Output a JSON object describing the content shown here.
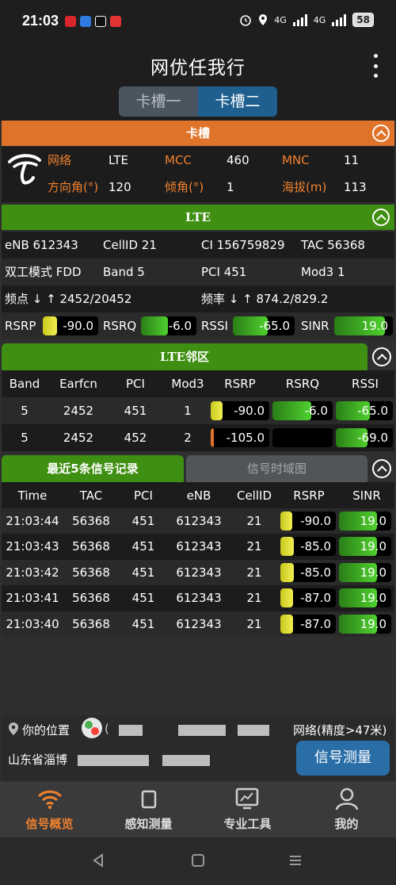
{
  "status": {
    "time": "21:03",
    "battery": "58",
    "net1": "4G",
    "net2": "4G"
  },
  "appbar": {
    "title": "网优任我行"
  },
  "slots": {
    "tab1": "卡槽一",
    "tab2": "卡槽二"
  },
  "sim": {
    "header": "卡槽",
    "row1": {
      "l1": "网络",
      "v1": "LTE",
      "l2": "MCC",
      "v2": "460",
      "l3": "MNC",
      "v3": "11"
    },
    "row2": {
      "l1": "方向角(°)",
      "v1": "120",
      "l2": "倾角(°)",
      "v2": "1",
      "l3": "海拔(m)",
      "v3": "113"
    }
  },
  "lte": {
    "header": "LTE",
    "enb": "eNB 612343",
    "cellid": "CellID 21",
    "ci": "CI 156759829",
    "tac": "TAC 56368",
    "duplex": "双工模式 FDD",
    "band": "Band 5",
    "pci": "PCI 451",
    "mod3": "Mod3 1",
    "freqpoint": "频点 ↓ ↑ 2452/20452",
    "freq": "频率 ↓ ↑ 874.2/829.2",
    "metrics": {
      "rsrp_label": "RSRP",
      "rsrp": "-90.0",
      "rsrp_level": 0.25,
      "rsrq_label": "RSRQ",
      "rsrq": "-6.0",
      "rsrq_level": 0.48,
      "rssi_label": "RSSI",
      "rssi": "-65.0",
      "rssi_level": 0.57,
      "sinr_label": "SINR",
      "sinr": "19.0",
      "sinr_level": 0.86
    }
  },
  "neighbors": {
    "header": "LTE邻区",
    "columns": [
      "Band",
      "Earfcn",
      "PCI",
      "Mod3",
      "RSRP",
      "RSRQ",
      "RSSI"
    ],
    "rows": [
      {
        "band": "5",
        "earfcn": "2452",
        "pci": "451",
        "mod3": "1",
        "rsrp": "-90.0",
        "rsrp_level": 0.2,
        "rsrq": "-6.0",
        "rsrq_level": 0.65,
        "rssi": "-65.0",
        "rssi_level": 0.6
      },
      {
        "band": "5",
        "earfcn": "2452",
        "pci": "452",
        "mod3": "2",
        "rsrp": "-105.0",
        "rsrp_level": 0.05,
        "rsrq": "",
        "rsrq_level": 0,
        "rssi": "-69.0",
        "rssi_level": 0.55
      }
    ]
  },
  "records": {
    "tab_active": "最近5条信号记录",
    "tab_inactive": "信号时域图",
    "columns": [
      "Time",
      "TAC",
      "PCI",
      "eNB",
      "CellID",
      "RSRP",
      "SINR"
    ],
    "rows": [
      {
        "time": "21:03:44",
        "tac": "56368",
        "pci": "451",
        "enb": "612343",
        "cellid": "21",
        "rsrp": "-90.0",
        "rsrp_level": 0.22,
        "sinr": "19.0",
        "sinr_level": 0.72
      },
      {
        "time": "21:03:43",
        "tac": "56368",
        "pci": "451",
        "enb": "612343",
        "cellid": "21",
        "rsrp": "-85.0",
        "rsrp_level": 0.24,
        "sinr": "19.0",
        "sinr_level": 0.72
      },
      {
        "time": "21:03:42",
        "tac": "56368",
        "pci": "451",
        "enb": "612343",
        "cellid": "21",
        "rsrp": "-85.0",
        "rsrp_level": 0.24,
        "sinr": "19.0",
        "sinr_level": 0.72
      },
      {
        "time": "21:03:41",
        "tac": "56368",
        "pci": "451",
        "enb": "612343",
        "cellid": "21",
        "rsrp": "-87.0",
        "rsrp_level": 0.23,
        "sinr": "19.0",
        "sinr_level": 0.72
      },
      {
        "time": "21:03:40",
        "tac": "56368",
        "pci": "451",
        "enb": "612343",
        "cellid": "21",
        "rsrp": "-87.0",
        "rsrp_level": 0.23,
        "sinr": "19.0",
        "sinr_level": 0.72
      }
    ]
  },
  "location": {
    "label": "你的位置",
    "accuracy": "网络(精度>47米)",
    "address": "山东省淄博",
    "button": "信号测量"
  },
  "nav": {
    "item1": "信号概览",
    "item2": "感知测量",
    "item3": "专业工具",
    "item4": "我的"
  },
  "colors": {
    "accent_orange": "#e0732a",
    "accent_green": "#3f8f12",
    "button_blue": "#2a6ea8",
    "yellow_bar": "#e8e43a"
  }
}
